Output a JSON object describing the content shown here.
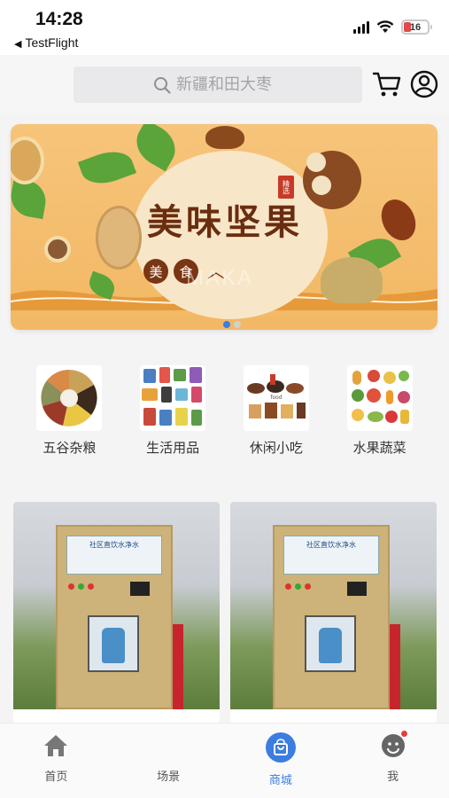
{
  "status_bar": {
    "time": "14:28",
    "back_app": "TestFlight",
    "battery": "16"
  },
  "search": {
    "placeholder": "新疆和田大枣"
  },
  "header": {
    "cart_icon": "cart-icon",
    "account_icon": "user-icon"
  },
  "banner": {
    "title": "美味坚果",
    "seal": "精选",
    "tags": [
      "美",
      "食"
    ],
    "watermark": "MAKA",
    "slides": 2,
    "active_slide": 1
  },
  "categories": [
    {
      "label": "五谷杂粮",
      "icon": "grains-icon"
    },
    {
      "label": "生活用品",
      "icon": "daily-goods-icon"
    },
    {
      "label": "休闲小吃",
      "icon": "snacks-icon"
    },
    {
      "label": "水果蔬菜",
      "icon": "fruit-vegetable-icon"
    }
  ],
  "products": [
    {
      "screen_title": "社区直饮水净水"
    },
    {
      "screen_title": "社区直饮水净水"
    }
  ],
  "tabbar": {
    "items": [
      {
        "label": "首页",
        "icon": "home-icon",
        "active": false
      },
      {
        "label": "场景",
        "icon": "scene-icon",
        "active": false
      },
      {
        "label": "商城",
        "icon": "shop-icon",
        "active": true
      },
      {
        "label": "我",
        "icon": "profile-icon",
        "active": false,
        "badge": true
      }
    ]
  },
  "colors": {
    "accent": "#3c7de0",
    "badge": "#e43d3d",
    "banner_bg": "#f2b864"
  }
}
